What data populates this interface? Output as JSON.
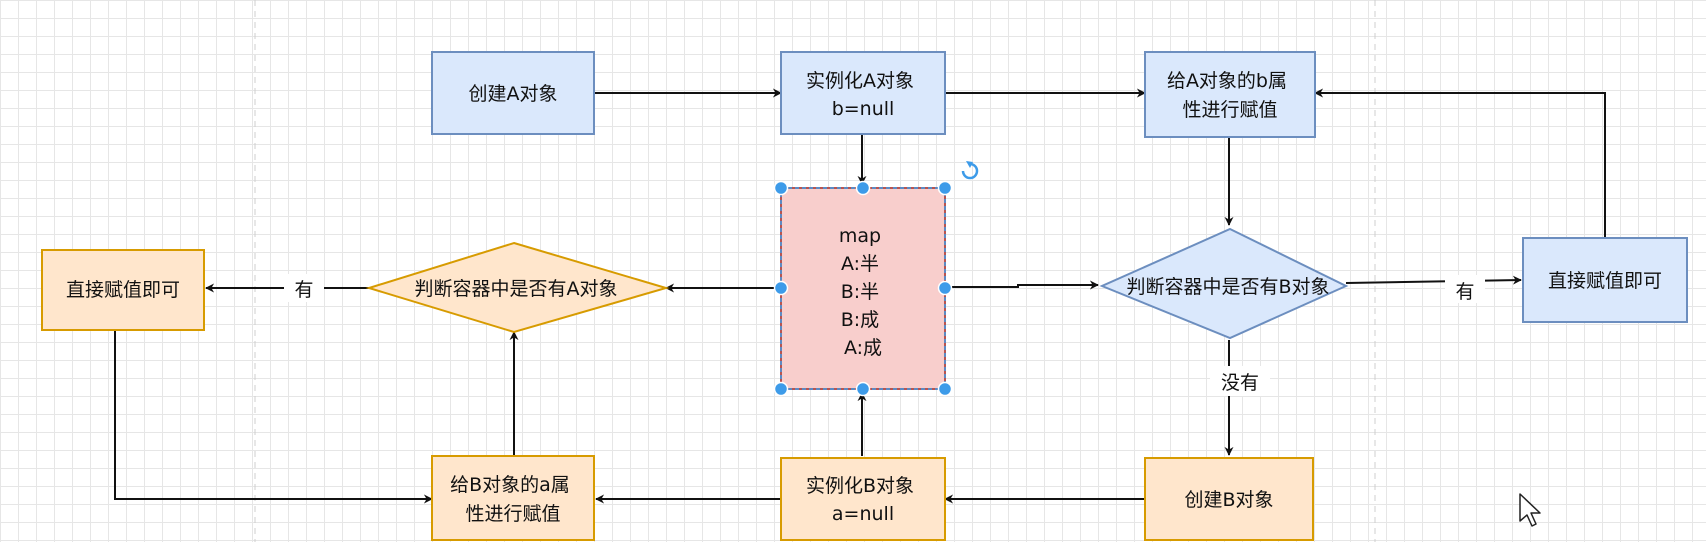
{
  "nodes": {
    "create_a": {
      "lines": [
        "创建A对象"
      ]
    },
    "instantiate_a": {
      "lines": [
        "实例化A对象",
        "b=null"
      ]
    },
    "assign_a_b": {
      "lines": [
        "给A对象的b属",
        "性进行赋值"
      ]
    },
    "map": {
      "lines": [
        "map",
        "A:半",
        "B:半",
        "B:成",
        "A:成"
      ]
    },
    "check_b": {
      "lines": [
        "判断容器中是否有B对象"
      ]
    },
    "direct_assign_right": {
      "lines": [
        "直接赋值即可"
      ]
    },
    "check_a": {
      "lines": [
        "判断容器中是否有A对象"
      ]
    },
    "direct_assign_left": {
      "lines": [
        "直接赋值即可"
      ]
    },
    "assign_b_a": {
      "lines": [
        "给B对象的a属",
        "性进行赋值"
      ]
    },
    "instantiate_b": {
      "lines": [
        "实例化B对象",
        "a=null"
      ]
    },
    "create_b": {
      "lines": [
        "创建B对象"
      ]
    }
  },
  "edge_labels": {
    "has_right": "有",
    "has_left": "有",
    "none_down": "没有"
  },
  "colors": {
    "blue_fill": "#dae8fc",
    "blue_stroke": "#6c8ebf",
    "orange_fill": "#ffe6cc",
    "orange_stroke": "#d79b00",
    "red_fill": "#f8cecc",
    "selection": "#3d9be9"
  }
}
